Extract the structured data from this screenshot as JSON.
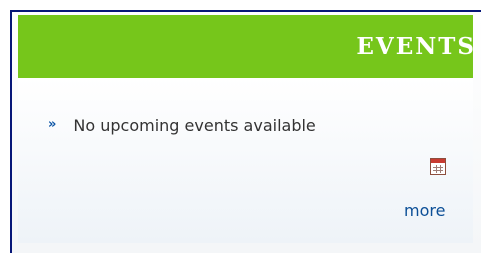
{
  "events_panel": {
    "title": "EVENTS",
    "message": "No upcoming events available",
    "bullet": "»",
    "more_label": "more"
  },
  "icons": {
    "bullet": "double-right-arrow",
    "calendar": "calendar-icon"
  },
  "colors": {
    "frame_border": "#071778",
    "header_background": "#76c61b",
    "header_text": "#ffffff",
    "body_text": "#333333",
    "link_text": "#0c4f97"
  }
}
